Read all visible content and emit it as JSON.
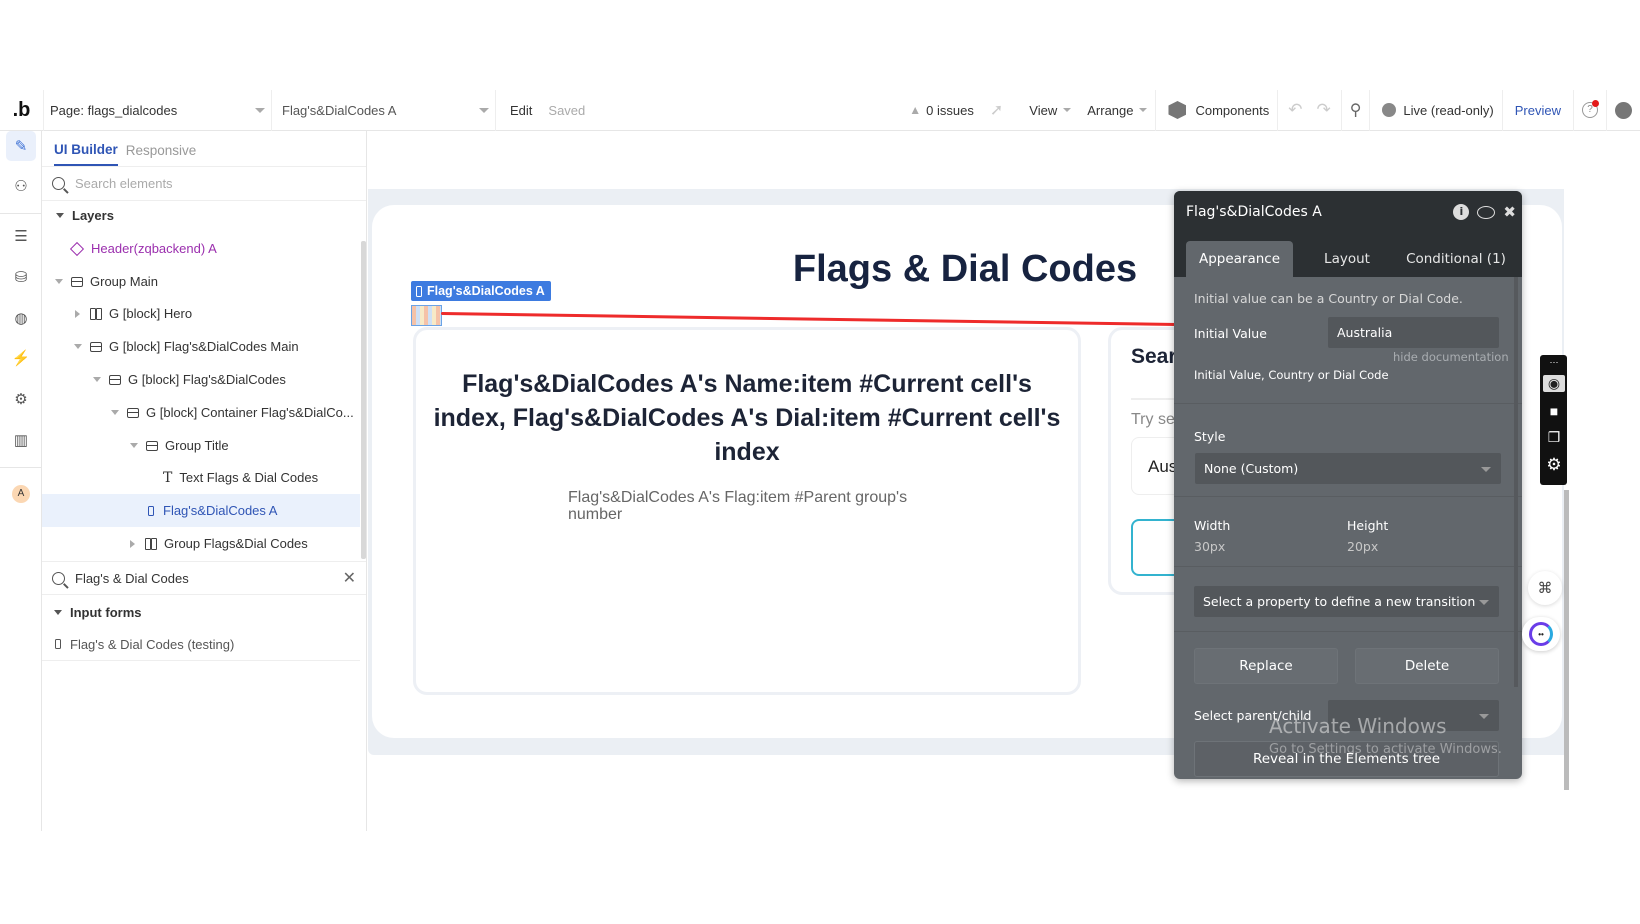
{
  "topbar": {
    "logo": ".b",
    "page_select": "Page: flags_dialcodes",
    "element_select": "Flag's&DialCodes A",
    "edit_label": "Edit",
    "saved_label": "Saved",
    "issues_label": "0 issues",
    "view_label": "View",
    "arrange_label": "Arrange",
    "components_label": "Components",
    "live_label": "Live (read-only)",
    "preview_label": "Preview",
    "icons": [
      "warning-icon",
      "inspect-cursor-icon",
      "cube-icon",
      "undo-icon",
      "redo-icon",
      "search-icon",
      "globe-icon",
      "help-icon",
      "user-icon"
    ]
  },
  "rail": {
    "items": [
      "design-pencil-icon",
      "workflow-icon",
      "data-icon",
      "database-icon",
      "styles-palette-icon",
      "plugins-icon",
      "settings-gear-icon",
      "logs-chart-icon"
    ],
    "avatar_initial": "A"
  },
  "panel": {
    "tabs": [
      {
        "label": "UI Builder",
        "active": true
      },
      {
        "label": "Responsive",
        "active": false
      }
    ],
    "search_placeholder": "Search elements",
    "layers_heading": "Layers",
    "tree": [
      {
        "label": "Header(zqbackend) A",
        "type": "reusable"
      },
      {
        "label": "Group Main",
        "type": "group",
        "expanded": true
      },
      {
        "label": "G [block] Hero",
        "type": "row",
        "expanded": false
      },
      {
        "label": "G [block] Flag's&DialCodes Main",
        "type": "group",
        "expanded": true
      },
      {
        "label": "G [block] Flag's&DialCodes",
        "type": "group",
        "expanded": true
      },
      {
        "label": "G [block] Container Flag's&DialCo...",
        "type": "group",
        "expanded": true
      },
      {
        "label": "Group Title",
        "type": "group",
        "expanded": true
      },
      {
        "label": "Text Flags & Dial Codes",
        "type": "text"
      },
      {
        "label": "Flag's&DialCodes A",
        "type": "plugin",
        "selected": true
      },
      {
        "label": "Group Flags&Dial Codes",
        "type": "row",
        "expanded": false
      }
    ],
    "filter_value": "Flag's & Dial Codes",
    "input_forms_heading": "Input forms",
    "input_forms_items": [
      "Flag's & Dial Codes (testing)"
    ]
  },
  "canvas": {
    "page_title": "Flags & Dial Codes",
    "selected_label": "Flag's&DialCodes A",
    "card_title": "Flag's&DialCodes A's Name:item #Current cell's index, Flag's&DialCodes A's Dial:item #Current cell's index",
    "card_subtitle": "Flag's&DialCodes A's Flag:item #Parent group's number",
    "side_card_title": "Sear",
    "side_card_hint": "Try se",
    "side_card_input": "Aus"
  },
  "editor": {
    "title": "Flag's&DialCodes A",
    "tabs": [
      {
        "label": "Appearance",
        "active": true
      },
      {
        "label": "Layout",
        "active": false
      },
      {
        "label": "Conditional (1)",
        "active": false
      }
    ],
    "doc_note": "Initial value can be a Country or Dial Code.",
    "initial_value_label": "Initial Value",
    "initial_value": "Australia",
    "hide_doc_link": "hide documentation",
    "initial_value_doc": "Initial Value, Country or Dial Code",
    "style_label": "Style",
    "style_value": "None (Custom)",
    "width_label": "Width",
    "width_value": "30px",
    "height_label": "Height",
    "height_value": "20px",
    "transition_placeholder": "Select a property to define a new transition",
    "replace_label": "Replace",
    "delete_label": "Delete",
    "parent_child_label": "Select parent/child",
    "reveal_label": "Reveal in the Elements tree"
  },
  "overlay": {
    "watermark_title": "Activate Windows",
    "watermark_sub": "Go to Settings to activate Windows."
  },
  "colors": {
    "accent_blue": "#2f55b5",
    "selection_blue": "#3d7be0",
    "annotation_red": "#ee2b2b",
    "editor_bg": "#62676c",
    "editor_header": "#2c3033",
    "reusable_purple": "#9b2fae",
    "title_navy": "#172340"
  }
}
